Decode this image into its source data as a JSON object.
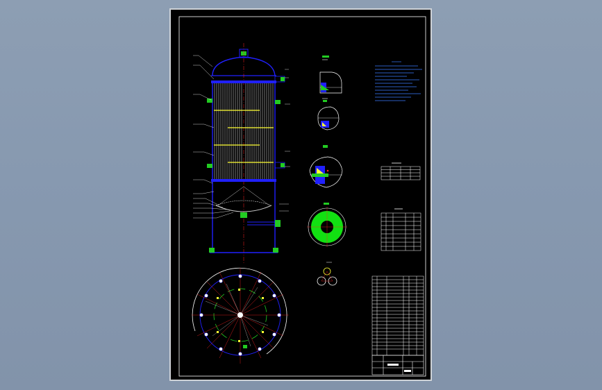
{
  "drawing": {
    "background": "#000000",
    "frame_color": "#ffffff",
    "outline_color": "#2020ff",
    "tube_color": "#c8c8c8",
    "baffle_color": "#ffff33",
    "nozzle_color": "#22cc22",
    "centerline_color": "#ff2222",
    "leader_color": "#ffffff",
    "note_color": "#3a7bff",
    "flange_fill": "#12e012",
    "tubesheet_hole_color": "#ffffff",
    "dim_color": "#ff3333"
  },
  "views": [
    {
      "id": "main-elevation",
      "kind": "vessel-elevation"
    },
    {
      "id": "section-plan",
      "kind": "tube-layout-plan"
    },
    {
      "id": "detail-1",
      "kind": "weld-detail"
    },
    {
      "id": "detail-2",
      "kind": "weld-detail"
    },
    {
      "id": "detail-3",
      "kind": "weld-detail"
    },
    {
      "id": "flange-view",
      "kind": "flange"
    },
    {
      "id": "tube-pattern",
      "kind": "tube-pattern"
    }
  ],
  "tables": [
    {
      "id": "design-data",
      "rows": 4,
      "cols": 4
    },
    {
      "id": "nozzle-table",
      "rows": 9,
      "cols": 5
    },
    {
      "id": "parts-list",
      "rows": 22,
      "cols": 6
    },
    {
      "id": "title-block",
      "rows": 3,
      "cols": 6
    }
  ]
}
